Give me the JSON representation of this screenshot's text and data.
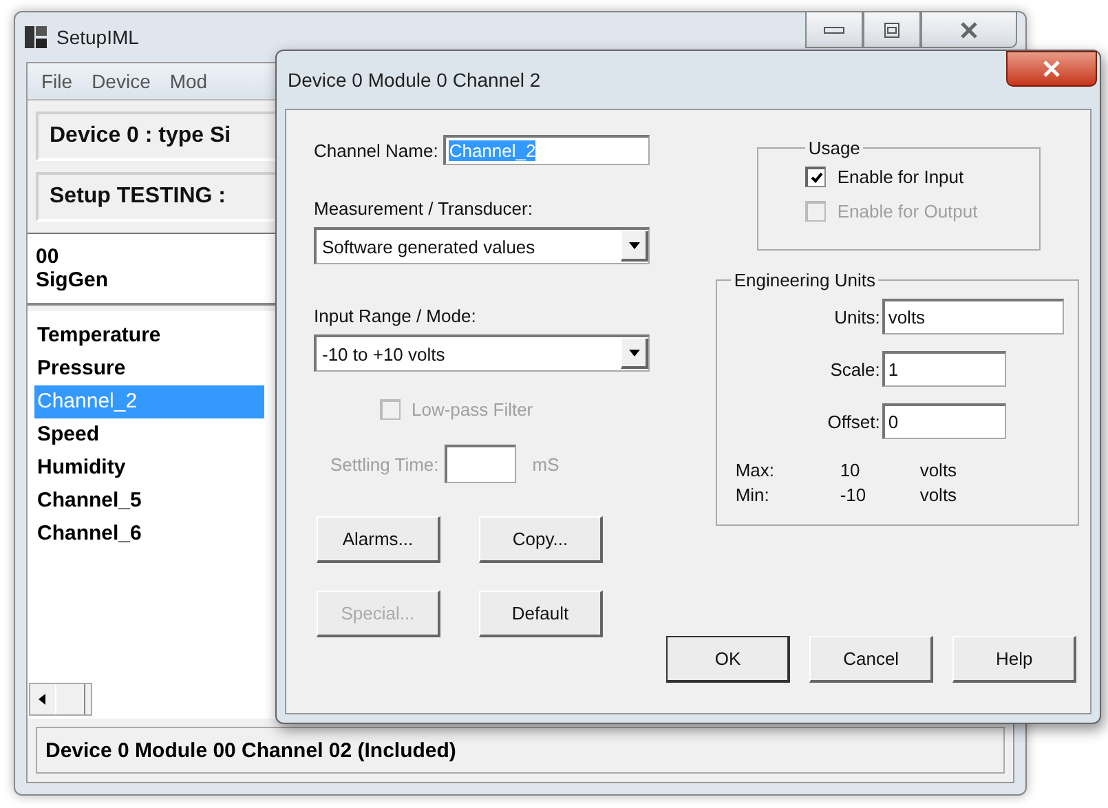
{
  "main_window": {
    "title": "SetupIML",
    "menu": [
      "File",
      "Device",
      "Mod"
    ],
    "header_fields": [
      "Device 0 : type Si",
      "Setup TESTING :"
    ],
    "info_lines": [
      "00",
      "SigGen"
    ],
    "channels": [
      {
        "name": "Temperature",
        "selected": false
      },
      {
        "name": "Pressure",
        "selected": false
      },
      {
        "name": "Channel_2",
        "selected": true
      },
      {
        "name": "Speed",
        "selected": false
      },
      {
        "name": "Humidity",
        "selected": false
      },
      {
        "name": "Channel_5",
        "selected": false
      },
      {
        "name": "Channel_6",
        "selected": false
      }
    ],
    "status": "Device 0 Module 00 Channel 02  (Included)"
  },
  "dialog": {
    "title": "Device 0  Module 0  Channel 2",
    "channel_name": {
      "label": "Channel Name:",
      "value": "Channel_2",
      "value_selected": true
    },
    "measurement": {
      "label": "Measurement / Transducer:",
      "value": "Software generated values"
    },
    "input_range": {
      "label": "Input Range / Mode:",
      "value": "-10  to  +10  volts"
    },
    "lowpass": {
      "label": "Low-pass Filter",
      "checked": false,
      "disabled": true
    },
    "settling": {
      "label": "Settling Time:",
      "unit": "mS",
      "disabled": true
    },
    "buttons": [
      {
        "label": "Alarms...",
        "disabled": false
      },
      {
        "label": "Copy...",
        "disabled": false
      },
      {
        "label": "Special...",
        "disabled": true
      },
      {
        "label": "Default",
        "disabled": false
      }
    ],
    "usage": {
      "title": "Usage",
      "options": [
        {
          "label": "Enable for Input",
          "checked": true,
          "disabled": false
        },
        {
          "label": "Enable for Output",
          "checked": false,
          "disabled": true
        }
      ]
    },
    "engineering_units": {
      "title": "Engineering Units",
      "fields": [
        {
          "label": "Units:",
          "value": "volts",
          "wide": true
        },
        {
          "label": "Scale:",
          "value": "1",
          "wide": false
        },
        {
          "label": "Offset:",
          "value": "0",
          "wide": false
        }
      ],
      "ranges": [
        {
          "label": "Max:",
          "value": "10",
          "unit": "volts"
        },
        {
          "label": "Min:",
          "value": "-10",
          "unit": "volts"
        }
      ]
    },
    "action_buttons": [
      "OK",
      "Cancel",
      "Help"
    ]
  }
}
